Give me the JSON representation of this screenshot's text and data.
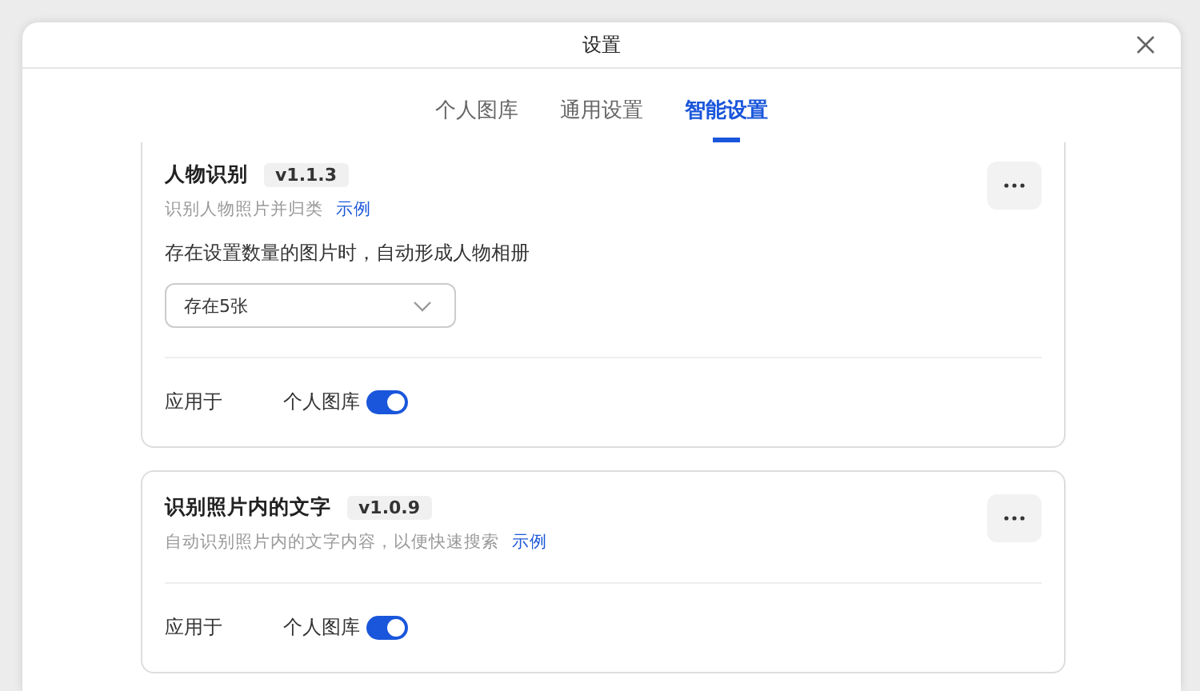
{
  "dialog": {
    "title": "设置"
  },
  "tabs": [
    {
      "label": "个人图库",
      "selected": false
    },
    {
      "label": "通用设置",
      "selected": false
    },
    {
      "label": "智能设置",
      "selected": true
    }
  ],
  "cards": [
    {
      "title": "人物识别",
      "version": "v1.1.3",
      "description": "识别人物照片并归类",
      "example_link": "示例",
      "setting": {
        "label": "存在设置数量的图片时，自动形成人物相册",
        "value": "存在5张"
      },
      "apply_label": "应用于",
      "apply_target": "个人图库",
      "on": true
    },
    {
      "title": "识别照片内的文字",
      "version": "v1.0.9",
      "description": "自动识别照片内的文字内容，以便快速搜索",
      "example_link": "示例",
      "apply_label": "应用于",
      "apply_target": "个人图库",
      "on": true
    }
  ]
}
